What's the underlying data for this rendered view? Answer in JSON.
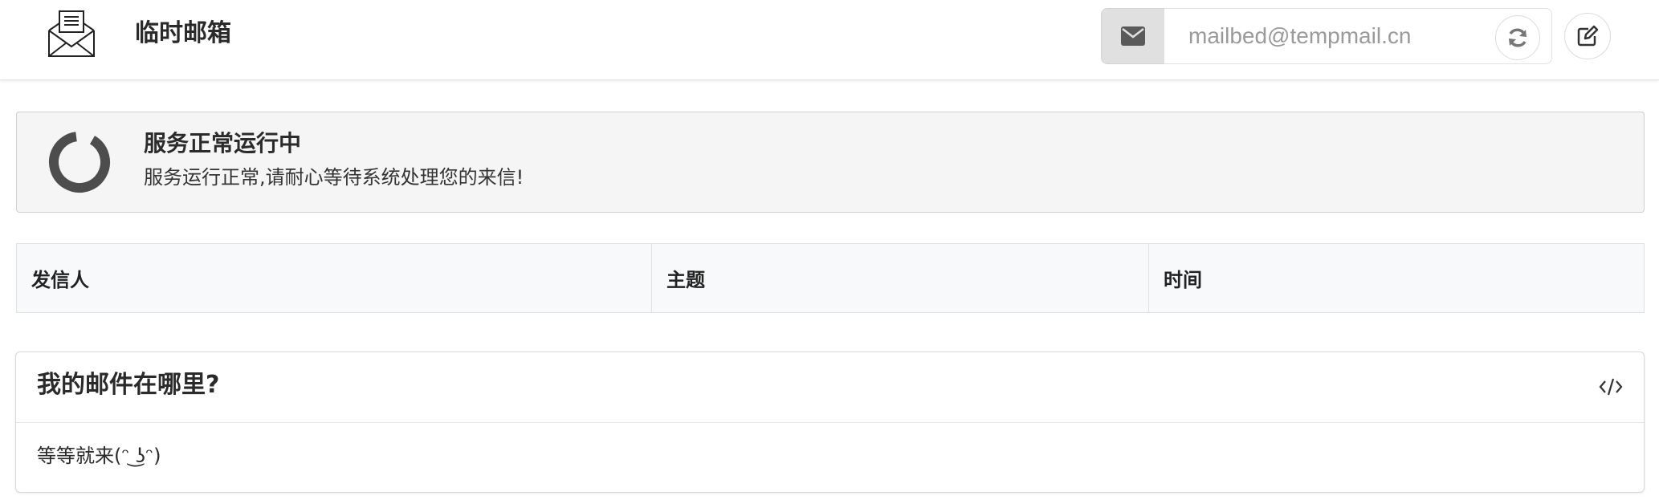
{
  "header": {
    "brand": "临时邮箱",
    "email_placeholder": "mailbed@tempmail.cn"
  },
  "status": {
    "title": "服务正常运行中",
    "description": "服务运行正常,请耐心等待系统处理您的来信!"
  },
  "table": {
    "columns": [
      "发信人",
      "主题",
      "时间"
    ]
  },
  "card": {
    "title": "我的邮件在哪里?",
    "body": "等等就来(ᵔ ͜ʖᵔ)"
  },
  "colors": {
    "addon_bg": "#e0e0e0",
    "icon_gray": "#5a5a5a",
    "spinner": "#4d4d4d",
    "status_bg": "#f5f5f5",
    "table_bg": "#f8f9fa"
  },
  "icons": {
    "logo": "envelope-letter-icon",
    "addon": "envelope-icon",
    "refresh": "refresh-icon",
    "edit": "edit-icon",
    "spinner": "spinner-icon",
    "card": "code-icon"
  }
}
